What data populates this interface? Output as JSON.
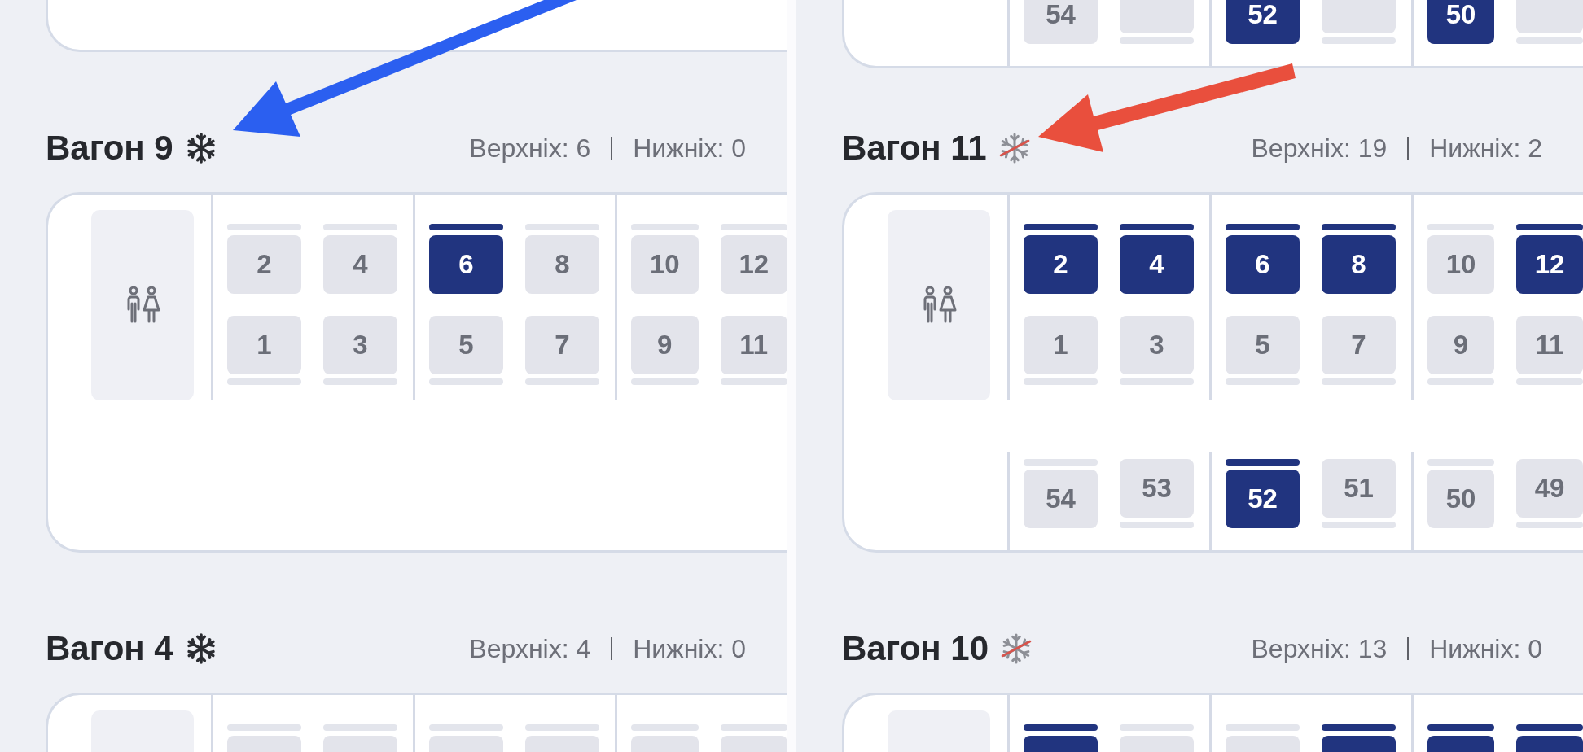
{
  "panels": [
    {
      "wagons": [
        {
          "kind": "bottom"
        },
        {
          "kind": "full",
          "title": "Вагон 9",
          "air_conditioning": true,
          "upper_count": "Верхніх: 6",
          "lower_count": "Нижніх: 0",
          "compartments": [
            {
              "upper": [
                {
                  "number": "2",
                  "available": false
                },
                {
                  "number": "4",
                  "available": false
                }
              ],
              "lower": [
                {
                  "number": "1",
                  "available": false
                },
                {
                  "number": "3",
                  "available": false
                }
              ]
            },
            {
              "upper": [
                {
                  "number": "6",
                  "available": true
                },
                {
                  "number": "8",
                  "available": false
                }
              ],
              "lower": [
                {
                  "number": "5",
                  "available": false
                },
                {
                  "number": "7",
                  "available": false
                }
              ]
            },
            {
              "upper": [
                {
                  "number": "10",
                  "available": false
                },
                {
                  "number": "12",
                  "available": false
                }
              ],
              "lower": [
                {
                  "number": "9",
                  "available": false
                },
                {
                  "number": "11",
                  "available": false
                }
              ]
            }
          ]
        },
        {
          "kind": "top",
          "title": "Вагон 4",
          "air_conditioning": true,
          "upper_count": "Верхніх: 4",
          "lower_count": "Нижніх: 0",
          "compartments": [
            {
              "upper": [
                {
                  "available": false
                },
                {
                  "available": false
                }
              ]
            },
            {
              "upper": [
                {
                  "available": false
                },
                {
                  "available": false
                }
              ]
            },
            {
              "upper": [
                {
                  "available": false
                },
                {
                  "available": false
                }
              ]
            }
          ]
        }
      ]
    },
    {
      "wagons": [
        {
          "kind": "bottom",
          "side_compartments": [
            {
              "seats": [
                {
                  "number": "54",
                  "available": false
                },
                {
                  "available": false
                }
              ]
            },
            {
              "seats": [
                {
                  "number": "52",
                  "available": true
                },
                {
                  "available": false
                }
              ]
            },
            {
              "seats": [
                {
                  "number": "50",
                  "available": true
                },
                {
                  "available": false
                }
              ]
            }
          ]
        },
        {
          "kind": "full",
          "title": "Вагон 11",
          "air_conditioning": false,
          "upper_count": "Верхніх: 19",
          "lower_count": "Нижніх: 2",
          "compartments": [
            {
              "upper": [
                {
                  "number": "2",
                  "available": true
                },
                {
                  "number": "4",
                  "available": true
                }
              ],
              "lower": [
                {
                  "number": "1",
                  "available": false
                },
                {
                  "number": "3",
                  "available": false
                }
              ]
            },
            {
              "upper": [
                {
                  "number": "6",
                  "available": true
                },
                {
                  "number": "8",
                  "available": true
                }
              ],
              "lower": [
                {
                  "number": "5",
                  "available": false
                },
                {
                  "number": "7",
                  "available": false
                }
              ]
            },
            {
              "upper": [
                {
                  "number": "10",
                  "available": false
                },
                {
                  "number": "12",
                  "available": true
                }
              ],
              "lower": [
                {
                  "number": "9",
                  "available": false
                },
                {
                  "number": "11",
                  "available": false
                }
              ]
            }
          ],
          "side_compartments": [
            {
              "seats": [
                {
                  "number": "54",
                  "available": false
                },
                {
                  "number": "53",
                  "available": false
                }
              ]
            },
            {
              "seats": [
                {
                  "number": "52",
                  "available": true
                },
                {
                  "number": "51",
                  "available": false
                }
              ]
            },
            {
              "seats": [
                {
                  "number": "50",
                  "available": false
                },
                {
                  "number": "49",
                  "available": false
                }
              ]
            }
          ]
        },
        {
          "kind": "top",
          "title": "Вагон 10",
          "air_conditioning": false,
          "upper_count": "Верхніх: 13",
          "lower_count": "Нижніх: 0",
          "compartments": [
            {
              "upper": [
                {
                  "available": true
                },
                {
                  "available": false
                }
              ]
            },
            {
              "upper": [
                {
                  "available": false
                },
                {
                  "available": true
                }
              ]
            },
            {
              "upper": [
                {
                  "available": true
                },
                {
                  "available": true
                }
              ]
            }
          ]
        }
      ]
    }
  ],
  "annotations": [
    {
      "color": "#2b5ff0"
    },
    {
      "color": "#e94f3d"
    }
  ]
}
